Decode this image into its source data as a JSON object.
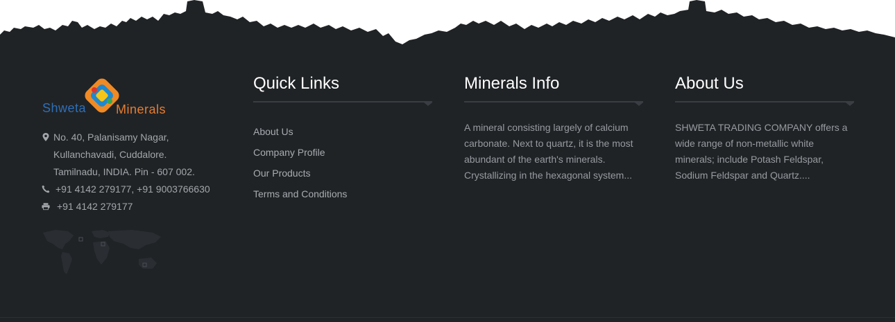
{
  "brand": {
    "word1": "Shweta",
    "word2": "Minerals"
  },
  "contact": {
    "address_lines": [
      "No. 40, Palanisamy Nagar,",
      "Kullanchavadi, Cuddalore.",
      "Tamilnadu, INDIA. Pin - 607 002."
    ],
    "phone": "+91 4142 279177, +91 9003766630",
    "fax": "+91 4142 279177",
    "icons": [
      "map-marker-icon",
      "phone-icon",
      "printer-icon"
    ]
  },
  "quick_links": {
    "title": "Quick Links",
    "items": [
      "About Us",
      "Company Profile",
      "Our Products",
      "Terms and Conditions"
    ]
  },
  "minerals_info": {
    "title": "Minerals Info",
    "text": "A mineral consisting largely of calcium carbonate. Next to quartz, it is the most abundant of the earth's minerals. Crystallizing in the hexagonal system..."
  },
  "about_us": {
    "title": "About Us",
    "text": "SHWETA TRADING COMPANY offers a wide range of non-metallic white minerals; include Potash Feldspar, Sodium Feldspar and Quartz...."
  },
  "colors": {
    "footer_bg": "#202326",
    "heading": "#ffffff",
    "link_text": "#a8acb0",
    "brand_blue": "#2e6fb7",
    "brand_orange": "#e77d2f"
  }
}
